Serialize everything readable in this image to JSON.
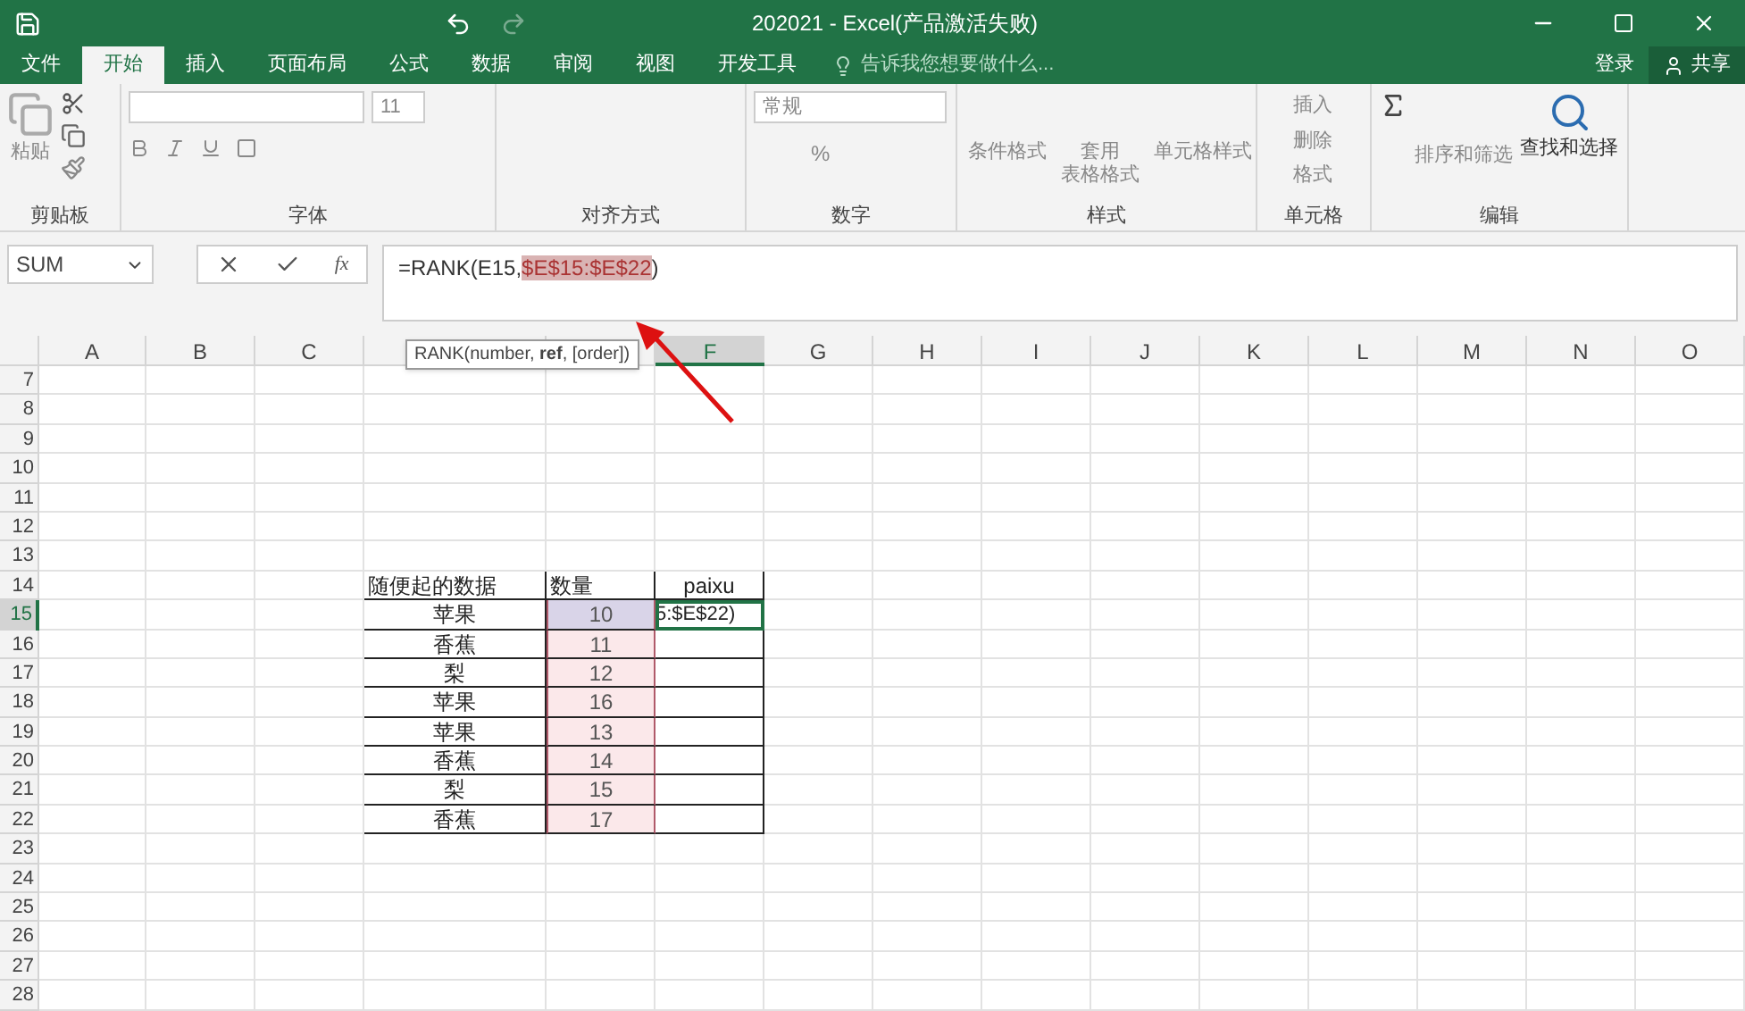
{
  "window": {
    "title": "202021 - Excel(产品激活失败)"
  },
  "tabs": [
    {
      "label": "文件",
      "selected": false
    },
    {
      "label": "开始",
      "selected": true
    },
    {
      "label": "插入",
      "selected": false
    },
    {
      "label": "页面布局",
      "selected": false
    },
    {
      "label": "公式",
      "selected": false
    },
    {
      "label": "数据",
      "selected": false
    },
    {
      "label": "审阅",
      "selected": false
    },
    {
      "label": "视图",
      "selected": false
    },
    {
      "label": "开发工具",
      "selected": false
    }
  ],
  "tell_me": {
    "placeholder": "告诉我您想要做什么..."
  },
  "account": {
    "sign_in": "登录",
    "share": "共享"
  },
  "ribbon": {
    "clipboard": {
      "label": "剪贴板",
      "paste": "粘贴"
    },
    "font": {
      "label": "字体",
      "size": "11"
    },
    "alignment": {
      "label": "对齐方式"
    },
    "number": {
      "label": "数字",
      "format": "常规",
      "percent": "%"
    },
    "styles": {
      "label": "样式",
      "buttons": [
        [
          "条件格式"
        ],
        [
          "套用",
          "表格格式"
        ],
        [
          "单元格样式"
        ]
      ]
    },
    "cells": {
      "label": "单元格",
      "buttons": [
        "插入",
        "删除",
        "格式"
      ]
    },
    "editing": {
      "label": "编辑",
      "buttons": [
        "排序和筛选",
        "查找和选择"
      ]
    }
  },
  "name_box": {
    "value": "SUM"
  },
  "function_label": "fx",
  "formula": {
    "prefix": "=RANK(E15,",
    "highlighted": "$E$15:$E$22",
    "suffix": ")"
  },
  "tooltip": "RANK(number, **ref**, [order])",
  "sheet": {
    "columns": [
      {
        "label": "A",
        "selected": false
      },
      {
        "label": "B",
        "selected": false
      },
      {
        "label": "C",
        "selected": false
      },
      {
        "selected": false
      },
      {
        "selected": false
      },
      {
        "label": "F",
        "selected": true
      },
      {
        "label": "G",
        "selected": false
      },
      {
        "label": "H",
        "selected": false
      },
      {
        "label": "I",
        "selected": false
      },
      {
        "label": "J",
        "selected": false
      },
      {
        "label": "K",
        "selected": false
      },
      {
        "label": "L",
        "selected": false
      },
      {
        "label": "M",
        "selected": false
      },
      {
        "label": "N",
        "selected": false
      },
      {
        "label": "O",
        "selected": false
      }
    ],
    "rows": [
      {
        "label": "7",
        "selected": false
      },
      {
        "label": "8",
        "selected": false
      },
      {
        "label": "9",
        "selected": false
      },
      {
        "label": "10",
        "selected": false
      },
      {
        "label": "11",
        "selected": false
      },
      {
        "label": "12",
        "selected": false
      },
      {
        "label": "13",
        "selected": false
      },
      {
        "label": "14",
        "selected": false
      },
      {
        "label": "15",
        "selected": true
      },
      {
        "label": "16",
        "selected": false
      },
      {
        "label": "17",
        "selected": false
      },
      {
        "label": "18",
        "selected": false
      },
      {
        "label": "19",
        "selected": false
      },
      {
        "label": "20",
        "selected": false
      },
      {
        "label": "21",
        "selected": false
      },
      {
        "label": "22",
        "selected": false
      },
      {
        "label": "23",
        "selected": false
      },
      {
        "label": "24",
        "selected": false
      },
      {
        "label": "25",
        "selected": false
      },
      {
        "label": "26",
        "selected": false
      },
      {
        "label": "27",
        "selected": false
      },
      {
        "label": "28",
        "selected": false
      }
    ],
    "table": {
      "header": [
        "随便起的数据",
        "数量",
        "paixu"
      ],
      "rows": [
        [
          "苹果",
          "10",
          "5:$E$22)"
        ],
        [
          "香蕉",
          "11"
        ],
        [
          "梨",
          "12"
        ],
        [
          "苹果",
          "16"
        ],
        [
          "苹果",
          "13"
        ],
        [
          "香蕉",
          "14"
        ],
        [
          "梨",
          "15"
        ],
        [
          "香蕉",
          "17"
        ]
      ]
    }
  }
}
